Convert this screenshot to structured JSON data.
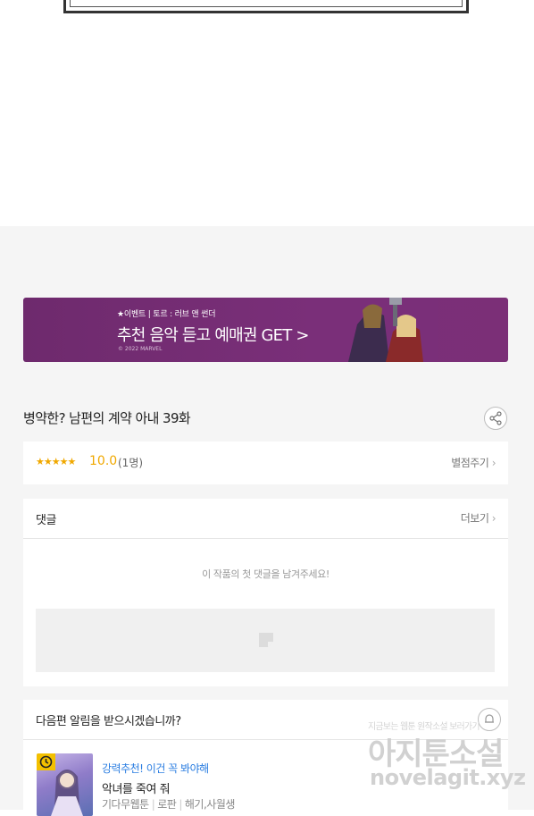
{
  "banner": {
    "event": "★이벤트 | 토르 : 러브 앤 썬더",
    "headline": "추천 음악 듣고 예매권 GET >",
    "copyright": "© 2022 MARVEL"
  },
  "episode": {
    "title": "병약한? 남편의 계약 아내 39화"
  },
  "rating": {
    "stars": "★★★★★",
    "score": "10.0",
    "count": "(1명)",
    "rate_link": "별점주기"
  },
  "comments": {
    "title": "댓글",
    "more": "더보기",
    "empty_message": "이 작품의 첫 댓글을 남겨주세요!"
  },
  "next_episode": {
    "prompt": "다음편 알림을 받으시겠습니까?",
    "recommendation": {
      "promo": "강력추천! 이건 꼭 봐야해",
      "title": "악녀를 죽여 줘",
      "meta": [
        "기다무웹툰",
        "로판",
        "해기,사월생"
      ]
    }
  },
  "watermark": {
    "top": "지금보는 웹툰 원작소설 보러가기",
    "main": "아지툰소설",
    "url": "novelagit.xyz"
  },
  "colors": {
    "banner_bg": "#7a2f79",
    "star": "#f0a800",
    "promo_link": "#2a7de1"
  }
}
